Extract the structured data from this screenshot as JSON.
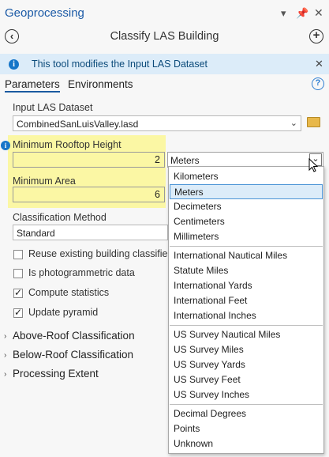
{
  "pane": {
    "title": "Geoprocessing"
  },
  "header": {
    "tool_title": "Classify LAS Building"
  },
  "banner": {
    "message": "This tool modifies the Input LAS Dataset"
  },
  "tabs": {
    "parameters": "Parameters",
    "environments": "Environments"
  },
  "params": {
    "input_las": {
      "label": "Input LAS Dataset",
      "value": "CombinedSanLuisValley.lasd"
    },
    "min_rooftop": {
      "label": "Minimum Rooftop Height",
      "value": "2",
      "units": "Meters"
    },
    "min_area": {
      "label": "Minimum Area",
      "value": "6"
    },
    "class_method": {
      "label": "Classification Method",
      "value": "Standard"
    }
  },
  "checkboxes": [
    {
      "label": "Reuse existing building classified",
      "checked": false
    },
    {
      "label": "Is photogrammetric data",
      "checked": false
    },
    {
      "label": "Compute statistics",
      "checked": true
    },
    {
      "label": "Update pyramid",
      "checked": true
    }
  ],
  "sections": [
    "Above-Roof Classification",
    "Below-Roof Classification",
    "Processing Extent"
  ],
  "units_dropdown": {
    "selected": "Meters",
    "groups": [
      [
        "Kilometers",
        "Meters",
        "Decimeters",
        "Centimeters",
        "Millimeters"
      ],
      [
        "International Nautical Miles",
        "Statute Miles",
        "International Yards",
        "International Feet",
        "International Inches"
      ],
      [
        "US Survey Nautical Miles",
        "US Survey Miles",
        "US Survey Yards",
        "US Survey Feet",
        "US Survey Inches"
      ],
      [
        "Decimal Degrees",
        "Points",
        "Unknown"
      ]
    ]
  }
}
